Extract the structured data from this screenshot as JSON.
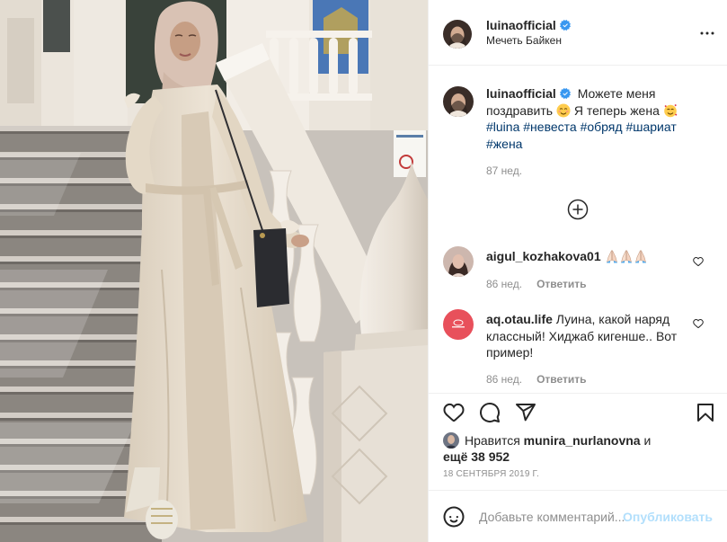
{
  "header": {
    "username": "luinaofficial",
    "verified_icon": "verified-badge-icon",
    "location": "Мечеть Байкен",
    "more_icon": "more-options-icon"
  },
  "caption": {
    "username": "luinaofficial",
    "text_1": "Можете меня поздравить",
    "emoji_1": "smiling-face-with-smiling-eyes-emoji",
    "text_2": "Я теперь жена",
    "emoji_2": "smiling-face-with-hearts-emoji",
    "hashtags": [
      "#luina",
      "#невеста",
      "#обряд",
      "#шариат",
      "#жена"
    ],
    "time": "87 нед."
  },
  "load_more_icon": "plus-circle-icon",
  "comments": [
    {
      "username": "aigul_kozhakova01",
      "emoji": [
        "folded-hands-emoji",
        "folded-hands-emoji",
        "folded-hands-emoji"
      ],
      "time": "86 нед.",
      "reply_label": "Ответить",
      "like_icon": "heart-icon"
    },
    {
      "username": "aq.otau.life",
      "text": "Луина, какой наряд классный! Хиджаб кигенше.. Вот пример!",
      "time": "86 нед.",
      "reply_label": "Ответить",
      "like_icon": "heart-icon"
    }
  ],
  "actions": {
    "like_icon": "heart-icon",
    "comment_icon": "comment-icon",
    "share_icon": "paper-plane-icon",
    "save_icon": "bookmark-icon"
  },
  "likes": {
    "prefix": "Нравится",
    "user": "munira_nurlanovna",
    "connector": "и",
    "others": "ещё 38 952"
  },
  "date": "18 СЕНТЯБРЯ 2019 Г.",
  "comment_box": {
    "emoji_icon": "smiley-icon",
    "placeholder": "Добавьте комментарий...",
    "publish_label": "Опубликовать"
  },
  "colors": {
    "link": "#00376b",
    "publish": "#b2dffc",
    "muted": "#8e8e8e",
    "text": "#262626",
    "verified": "#3897f0"
  }
}
